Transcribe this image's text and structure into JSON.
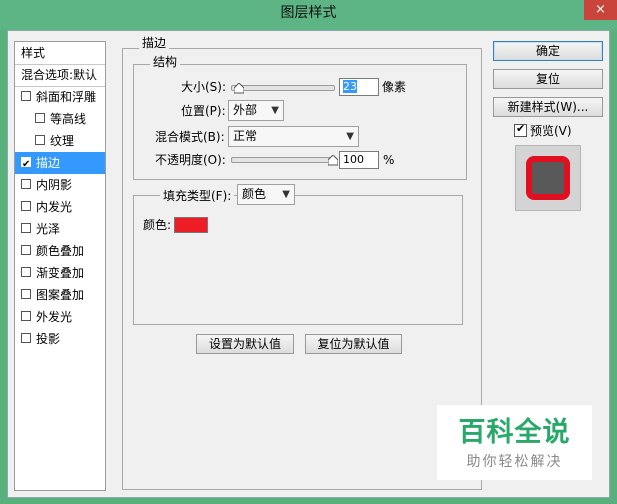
{
  "window": {
    "title": "图层样式",
    "close_label": "×"
  },
  "list": {
    "header": "样式",
    "blend_options": "混合选项:默认",
    "items": [
      {
        "label": "斜面和浮雕",
        "checked": false
      },
      {
        "label": "等高线",
        "checked": false
      },
      {
        "label": "纹理",
        "checked": false
      },
      {
        "label": "描边",
        "checked": true
      },
      {
        "label": "内阴影",
        "checked": false
      },
      {
        "label": "内发光",
        "checked": false
      },
      {
        "label": "光泽",
        "checked": false
      },
      {
        "label": "颜色叠加",
        "checked": false
      },
      {
        "label": "渐变叠加",
        "checked": false
      },
      {
        "label": "图案叠加",
        "checked": false
      },
      {
        "label": "外发光",
        "checked": false
      },
      {
        "label": "投影",
        "checked": false
      }
    ]
  },
  "stroke": {
    "group_title": "描边",
    "structure": {
      "group_title": "结构",
      "size_label": "大小(S):",
      "size_value": "23",
      "size_unit": "像素",
      "size_slider_fraction": 0.08,
      "position_label": "位置(P):",
      "position_value": "外部",
      "blend_label": "混合模式(B):",
      "blend_value": "正常",
      "opacity_label": "不透明度(O):",
      "opacity_value": "100",
      "opacity_unit": "%",
      "opacity_slider_fraction": 1.0
    },
    "fill": {
      "type_label": "填充类型(F):",
      "type_value": "颜色",
      "color_label": "颜色:",
      "color": "#ee1c24"
    },
    "set_default": "设置为默认值",
    "reset_default": "复位为默认值"
  },
  "buttons": {
    "ok": "确定",
    "reset": "复位",
    "new_style": "新建样式(W)...",
    "preview_label": "预览(V)",
    "preview_checked": true
  },
  "preview": {
    "stroke_color": "#e01020",
    "fill_color": "#595959"
  },
  "watermark": {
    "main": "百科全说",
    "sub": "助你轻松解决"
  },
  "colors": {
    "titlebar": "#5db585",
    "selection": "#3399ff"
  }
}
